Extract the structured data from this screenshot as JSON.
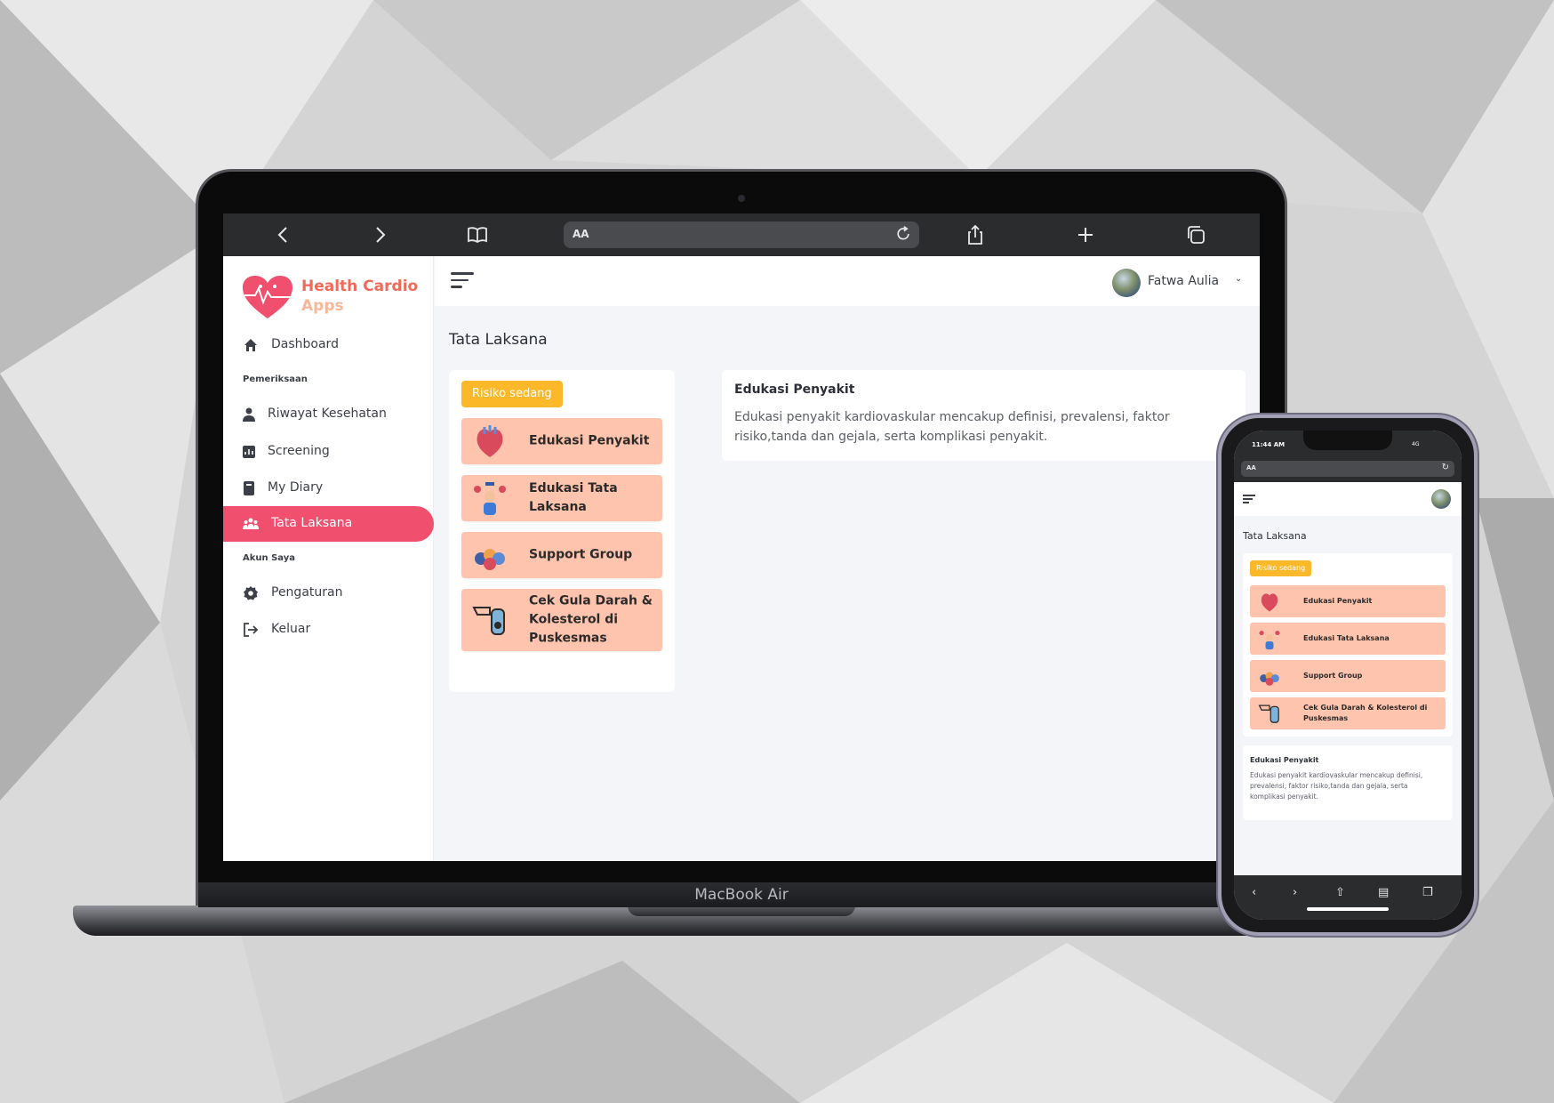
{
  "laptop": {
    "brand_label": "MacBook Air",
    "browser": {
      "url_text": "AA",
      "icons": [
        "chevron-left-icon",
        "chevron-right-icon",
        "book-icon",
        "reload-icon",
        "share-icon",
        "plus-icon",
        "tabs-icon"
      ]
    },
    "app": {
      "logo_line1": "Health Cardio",
      "logo_line2": "Apps",
      "sidebar": {
        "dashboard": "Dashboard",
        "section_pemeriksaan": "Pemeriksaan",
        "riwayat": "Riwayat Kesehatan",
        "screening": "Screening",
        "my_diary": "My Diary",
        "tata_laksana": "Tata Laksana",
        "section_akun": "Akun Saya",
        "pengaturan": "Pengaturan",
        "keluar": "Keluar"
      },
      "user_name": "Fatwa Aulia",
      "page_title": "Tata Laksana",
      "risk_badge": "Risiko sedang",
      "menu": [
        "Edukasi Penyakit",
        "Edukasi Tata Laksana",
        "Support Group",
        "Cek Gula Darah & Kolesterol di Puskesmas"
      ],
      "detail_title": "Edukasi Penyakit",
      "detail_text": "Edukasi penyakit kardiovaskular mencakup definisi, prevalensi, faktor risiko,tanda dan gejala, serta komplikasi penyakit."
    }
  },
  "phone": {
    "time": "11:44 AM",
    "signal": "4G",
    "url_text": "AA",
    "page_title": "Tata Laksana",
    "risk_badge": "Risiko sedang",
    "menu": [
      "Edukasi Penyakit",
      "Edukasi Tata Laksana",
      "Support Group",
      "Cek Gula Darah & Kolesterol di Puskesmas"
    ],
    "detail_title": "Edukasi Penyakit",
    "detail_text": "Edukasi penyakit kardiovaskular mencakup definisi, prevalensi, faktor risiko,tanda dan gejala, serta komplikasi penyakit."
  },
  "colors": {
    "accent": "#f0506e",
    "badge": "#fbb829",
    "menu_button": "#fec4ad",
    "logo": "#f06a5a"
  }
}
